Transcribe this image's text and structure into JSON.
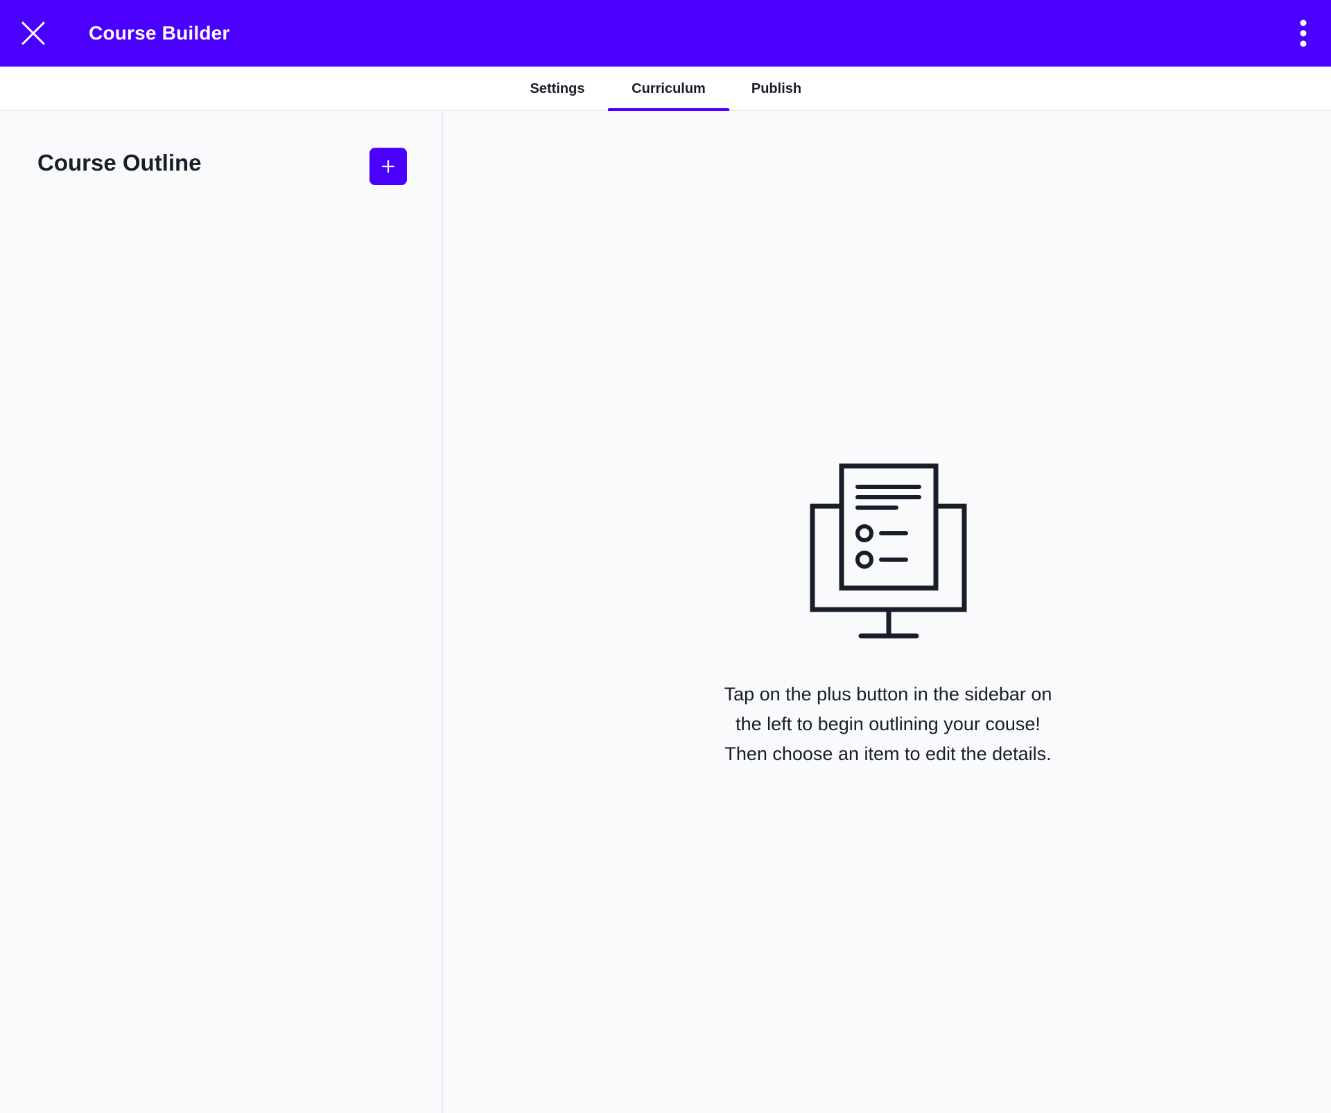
{
  "app_bar": {
    "title": "Course Builder",
    "close_icon": "close-icon",
    "more_icon": "more-vertical-icon",
    "background_color": "#4b00ff"
  },
  "tabs": [
    {
      "label": "Settings",
      "active": false
    },
    {
      "label": "Curriculum",
      "active": true
    },
    {
      "label": "Publish",
      "active": false
    }
  ],
  "sidebar": {
    "title": "Course Outline",
    "add_button_icon": "plus-icon"
  },
  "main": {
    "illustration_icon": "monitor-document-icon",
    "empty_message_lines": [
      "Tap on the plus button in the sidebar on",
      "the left to begin outlining your couse!",
      "Then choose an item to edit the details."
    ]
  },
  "colors": {
    "accent": "#4b00ff",
    "text": "#1a1d29",
    "background": "#f8fafc"
  }
}
